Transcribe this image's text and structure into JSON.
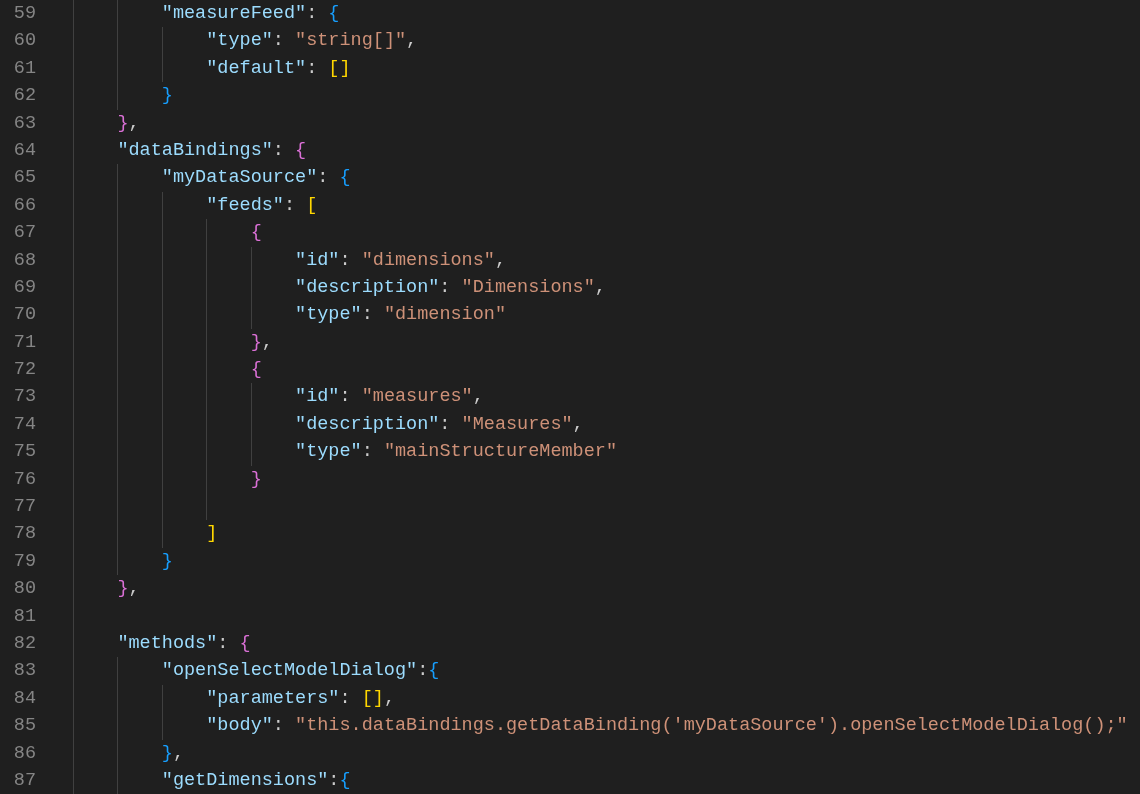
{
  "editor": {
    "lines": [
      {
        "children": [
          {
            "number": "59",
            "tokens": [
              {
                "kind": "key",
                "text": "\"measureFeed\""
              },
              {
                "kind": "punct",
                "text": ": "
              },
              {
                "kind": "bracket3",
                "text": "{"
              }
            ],
            "children": [
              {
                "number": "60",
                "tokens": [
                  {
                    "kind": "key",
                    "text": "\"type\""
                  },
                  {
                    "kind": "punct",
                    "text": ": "
                  },
                  {
                    "kind": "string",
                    "text": "\"string[]\""
                  },
                  {
                    "kind": "punct",
                    "text": ","
                  }
                ]
              },
              {
                "number": "61",
                "tokens": [
                  {
                    "kind": "key",
                    "text": "\"default\""
                  },
                  {
                    "kind": "punct",
                    "text": ": "
                  },
                  {
                    "kind": "bracket1",
                    "text": "[]"
                  }
                ]
              }
            ]
          },
          {
            "number": "62",
            "tokens": [
              {
                "kind": "bracket3",
                "text": "}"
              }
            ]
          }
        ]
      },
      {
        "number": "63",
        "tokens": [
          {
            "kind": "bracket2",
            "text": "}"
          },
          {
            "kind": "punct",
            "text": ","
          }
        ]
      },
      {
        "number": "64",
        "tokens": [
          {
            "kind": "key",
            "text": "\"dataBindings\""
          },
          {
            "kind": "punct",
            "text": ": "
          },
          {
            "kind": "bracket2",
            "text": "{"
          }
        ],
        "children": [
          {
            "number": "65",
            "tokens": [
              {
                "kind": "key",
                "text": "\"myDataSource\""
              },
              {
                "kind": "punct",
                "text": ": "
              },
              {
                "kind": "bracket3",
                "text": "{"
              }
            ],
            "children": [
              {
                "number": "66",
                "tokens": [
                  {
                    "kind": "key",
                    "text": "\"feeds\""
                  },
                  {
                    "kind": "punct",
                    "text": ": "
                  },
                  {
                    "kind": "bracket1",
                    "text": "["
                  }
                ],
                "children": [
                  {
                    "number": "67",
                    "tokens": [
                      {
                        "kind": "bracket2",
                        "text": "{"
                      }
                    ],
                    "children": [
                      {
                        "number": "68",
                        "tokens": [
                          {
                            "kind": "key",
                            "text": "\"id\""
                          },
                          {
                            "kind": "punct",
                            "text": ": "
                          },
                          {
                            "kind": "string",
                            "text": "\"dimensions\""
                          },
                          {
                            "kind": "punct",
                            "text": ","
                          }
                        ]
                      },
                      {
                        "number": "69",
                        "tokens": [
                          {
                            "kind": "key",
                            "text": "\"description\""
                          },
                          {
                            "kind": "punct",
                            "text": ": "
                          },
                          {
                            "kind": "string",
                            "text": "\"Dimensions\""
                          },
                          {
                            "kind": "punct",
                            "text": ","
                          }
                        ]
                      },
                      {
                        "number": "70",
                        "tokens": [
                          {
                            "kind": "key",
                            "text": "\"type\""
                          },
                          {
                            "kind": "punct",
                            "text": ": "
                          },
                          {
                            "kind": "string",
                            "text": "\"dimension\""
                          }
                        ]
                      }
                    ]
                  },
                  {
                    "number": "71",
                    "tokens": [
                      {
                        "kind": "bracket2",
                        "text": "}"
                      },
                      {
                        "kind": "punct",
                        "text": ","
                      }
                    ]
                  },
                  {
                    "number": "72",
                    "tokens": [
                      {
                        "kind": "bracket2",
                        "text": "{"
                      }
                    ],
                    "children": [
                      {
                        "number": "73",
                        "tokens": [
                          {
                            "kind": "key",
                            "text": "\"id\""
                          },
                          {
                            "kind": "punct",
                            "text": ": "
                          },
                          {
                            "kind": "string",
                            "text": "\"measures\""
                          },
                          {
                            "kind": "punct",
                            "text": ","
                          }
                        ]
                      },
                      {
                        "number": "74",
                        "tokens": [
                          {
                            "kind": "key",
                            "text": "\"description\""
                          },
                          {
                            "kind": "punct",
                            "text": ": "
                          },
                          {
                            "kind": "string",
                            "text": "\"Measures\""
                          },
                          {
                            "kind": "punct",
                            "text": ","
                          }
                        ]
                      },
                      {
                        "number": "75",
                        "tokens": [
                          {
                            "kind": "key",
                            "text": "\"type\""
                          },
                          {
                            "kind": "punct",
                            "text": ": "
                          },
                          {
                            "kind": "string",
                            "text": "\"mainStructureMember\""
                          }
                        ]
                      }
                    ]
                  },
                  {
                    "number": "76",
                    "tokens": [
                      {
                        "kind": "bracket2",
                        "text": "}"
                      }
                    ]
                  },
                  {
                    "number": "77"
                  }
                ]
              },
              {
                "number": "78",
                "tokens": [
                  {
                    "kind": "bracket1",
                    "text": "]"
                  }
                ]
              }
            ]
          },
          {
            "number": "79",
            "tokens": [
              {
                "kind": "bracket3",
                "text": "}"
              }
            ]
          }
        ]
      },
      {
        "number": "80",
        "tokens": [
          {
            "kind": "bracket2",
            "text": "}"
          },
          {
            "kind": "punct",
            "text": ","
          }
        ]
      },
      {
        "number": "81"
      },
      {
        "number": "82",
        "tokens": [
          {
            "kind": "key",
            "text": "\"methods\""
          },
          {
            "kind": "punct",
            "text": ": "
          },
          {
            "kind": "bracket2",
            "text": "{"
          }
        ],
        "children": [
          {
            "number": "83",
            "tokens": [
              {
                "kind": "key",
                "text": "\"openSelectModelDialog\""
              },
              {
                "kind": "punct",
                "text": ":"
              },
              {
                "kind": "bracket3",
                "text": "{"
              }
            ],
            "children": [
              {
                "number": "84",
                "tokens": [
                  {
                    "kind": "key",
                    "text": "\"parameters\""
                  },
                  {
                    "kind": "punct",
                    "text": ": "
                  },
                  {
                    "kind": "bracket1",
                    "text": "[]"
                  },
                  {
                    "kind": "punct",
                    "text": ","
                  }
                ]
              },
              {
                "number": "85",
                "tokens": [
                  {
                    "kind": "key",
                    "text": "\"body\""
                  },
                  {
                    "kind": "punct",
                    "text": ": "
                  },
                  {
                    "kind": "string",
                    "text": "\"this.dataBindings.getDataBinding('myDataSource').openSelectModelDialog();\""
                  }
                ]
              }
            ]
          },
          {
            "number": "86",
            "tokens": [
              {
                "kind": "bracket3",
                "text": "}"
              },
              {
                "kind": "punct",
                "text": ","
              }
            ]
          },
          {
            "number": "87",
            "tokens": [
              {
                "kind": "key",
                "text": "\"getDimensions\""
              },
              {
                "kind": "punct",
                "text": ":"
              },
              {
                "kind": "bracket3",
                "text": "{"
              }
            ]
          }
        ]
      }
    ]
  }
}
